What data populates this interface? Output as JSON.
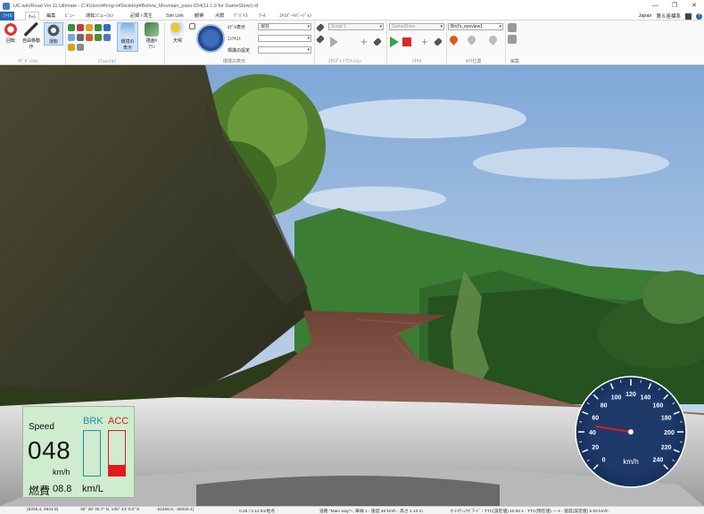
{
  "window": {
    "title": "UC-win/Road Ver.11 Ultimate - C:¥Users¥feng-v¥Desktop¥Bolivia_Mountain_pass-034(11.1.0 for GameShow).rd",
    "minimize": "—",
    "maximize": "❐",
    "close": "✕"
  },
  "tabs": {
    "items": [
      {
        "label": "ﾌｧｲﾙ"
      },
      {
        "label": "ﾎｰﾑ"
      },
      {
        "label": "編集"
      },
      {
        "label": "ﾋﾞｭｰ"
      },
      {
        "label": "運転ｼﾐｭﾚｰｼｮﾝ"
      },
      {
        "label": "記録 / 再生"
      },
      {
        "label": "Sim Link"
      },
      {
        "label": "観察"
      },
      {
        "label": "点群"
      },
      {
        "label": "ﾃﾞﾊﾞｲｽ"
      },
      {
        "label": "ﾂｰﾙ"
      },
      {
        "label": "ｴｷｽﾊﾟｰﾄﾊﾞｰｼﾞｮﾝ"
      }
    ],
    "region": "Japan",
    "coord_system": "第６座標系"
  },
  "ribbon": {
    "navigation": {
      "rotate": "回転",
      "free_move": "自由移動",
      "free_move2": "作",
      "drive": "運転",
      "group_label": "ﾅﾋﾞｹﾞｰｼｮﾝ"
    },
    "simulation": {
      "group_label": "ｼﾐｭﾚｰｼｮﾝ",
      "env_display": "環境の",
      "env_display2": "表示",
      "draw_anim": "描画ｷ",
      "draw_anim2": "ｱﾗﾝ"
    },
    "environment": {
      "weather": "天候",
      "model_display": "ﾓﾃﾞﾙ表示",
      "context": "ｺﾝﾃｷｽﾄ",
      "sign_setting": "標識の設定",
      "current": "現在",
      "group_label": "環境の表示"
    },
    "script": {
      "script_value": "Script 1",
      "group_label": "ｽｸﾘﾌﾟﾄ / ｱﾆﾒｰｼｮﾝ"
    },
    "scenario": {
      "scenario_value": "GameShow",
      "group_label": "ｼﾅﾘｵ"
    },
    "camera": {
      "camera_value": "Bird's_eyeview1",
      "group_label": "ｶﾒﾗ位置"
    },
    "edit": {
      "group_label": "編集"
    }
  },
  "hud": {
    "speed_label": "Speed",
    "speed_value": "048",
    "speed_unit": "km/h",
    "brk_label": "BRK",
    "acc_label": "ACC",
    "brk_level": 0.0,
    "acc_level": 0.25,
    "fuel_label": "燃費",
    "fuel_value": "08.8",
    "fuel_unit": "km/L"
  },
  "speedometer": {
    "ticks": [
      "0",
      "20",
      "40",
      "60",
      "80",
      "100",
      "120",
      "140",
      "160",
      "180",
      "200",
      "220",
      "240"
    ],
    "unit": "km/h",
    "max": 240,
    "value": 48
  },
  "statusbar": {
    "coords": "(6336.4, 2641.9)",
    "latlon": "35° 26' 36.7\" N, 135° 34' 0.0\" E",
    "xy": "-61606.0, -39325.4)",
    "distance": "0.26 / 2.12 km地点",
    "route": "道路 \"Main way\"+, 車線 1 - 速度 48 km/h - 高さ 1.10 m",
    "auto": "ｵｰﾄﾏﾃｨｯｸｷﾞｱｰﾄﾞ - TTC(設定値) 10.00 s - TTC(現在値) --- s - 速度(設定値) 5.00 km/h"
  },
  "colors": {
    "sky_top": "#7fa7d6",
    "sky_bottom": "#c9dbeb",
    "grass": "#3b7d33",
    "road": "#7a4a3c",
    "rock": "#3e3e2c",
    "hud_bg": "#cfeccf",
    "brk": "#1f8fa0",
    "acc": "#e21a1a",
    "speedo": "#1e3a6b"
  }
}
